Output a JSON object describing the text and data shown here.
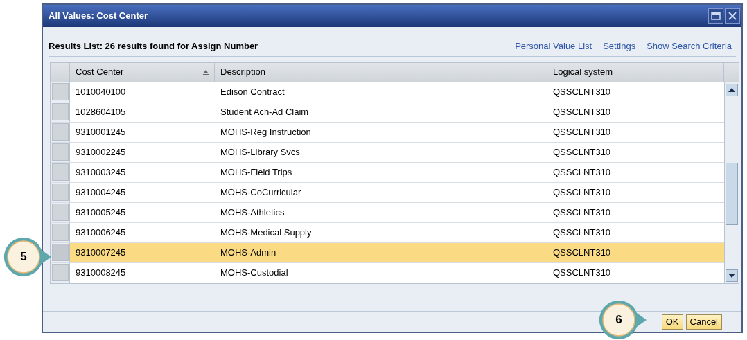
{
  "window": {
    "title": "All Values: Cost Center"
  },
  "results_heading": "Results List: 26 results found for Assign Number",
  "links": [
    "Personal Value List",
    "Settings",
    "Show Search Criteria"
  ],
  "table": {
    "columns": [
      {
        "label": "Cost Center",
        "sorted": true
      },
      {
        "label": "Description",
        "sorted": false
      },
      {
        "label": "Logical system",
        "sorted": false
      }
    ],
    "rows": [
      {
        "cells": [
          "1010040100",
          "Edison Contract",
          "QSSCLNT310"
        ],
        "selected": false
      },
      {
        "cells": [
          "1028604105",
          "Student Ach-Ad Claim",
          "QSSCLNT310"
        ],
        "selected": false
      },
      {
        "cells": [
          "9310001245",
          "MOHS-Reg Instruction",
          "QSSCLNT310"
        ],
        "selected": false
      },
      {
        "cells": [
          "9310002245",
          "MOHS-Library Svcs",
          "QSSCLNT310"
        ],
        "selected": false
      },
      {
        "cells": [
          "9310003245",
          "MOHS-Field Trips",
          "QSSCLNT310"
        ],
        "selected": false
      },
      {
        "cells": [
          "9310004245",
          "MOHS-CoCurricular",
          "QSSCLNT310"
        ],
        "selected": false
      },
      {
        "cells": [
          "9310005245",
          "MOHS-Athletics",
          "QSSCLNT310"
        ],
        "selected": false
      },
      {
        "cells": [
          "9310006245",
          "MOHS-Medical Supply",
          "QSSCLNT310"
        ],
        "selected": false
      },
      {
        "cells": [
          "9310007245",
          "MOHS-Admin",
          "QSSCLNT310"
        ],
        "selected": true
      },
      {
        "cells": [
          "9310008245",
          "MOHS-Custodial",
          "QSSCLNT310"
        ],
        "selected": false
      }
    ]
  },
  "buttons": [
    "OK",
    "Cancel"
  ],
  "callouts": [
    {
      "label": "5",
      "kind": "row"
    },
    {
      "label": "6",
      "kind": "button"
    }
  ]
}
